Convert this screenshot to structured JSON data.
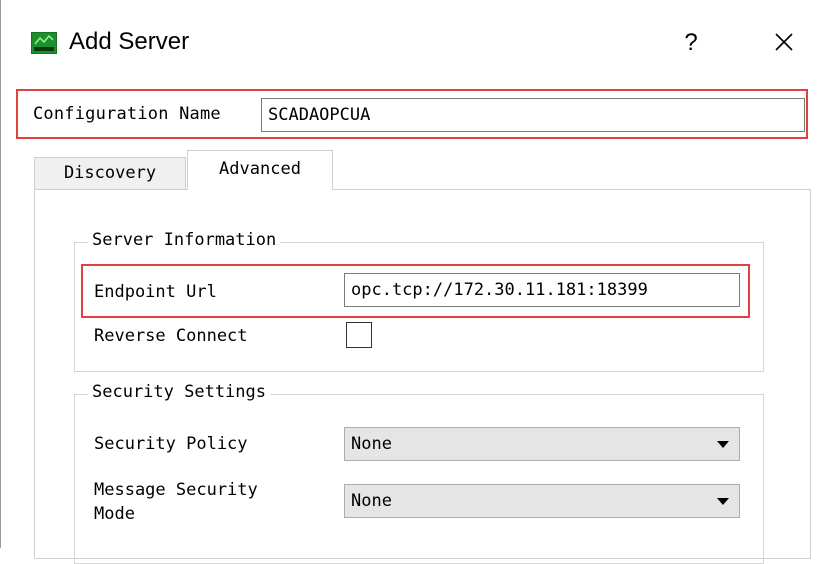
{
  "window": {
    "title": "Add Server",
    "help_label": "?",
    "close_label": "✕",
    "app_icon": "green-app-icon"
  },
  "config": {
    "label": "Configuration Name",
    "value": "SCADAOPCUA"
  },
  "tabs": [
    {
      "label": "Discovery"
    },
    {
      "label": "Advanced"
    }
  ],
  "server_info": {
    "title": "Server Information",
    "endpoint_label": "Endpoint Url",
    "endpoint_value": "opc.tcp://172.30.11.181:18399",
    "reverse_label": "Reverse Connect",
    "reverse_checked": false
  },
  "security": {
    "title": "Security Settings",
    "policy_label": "Security Policy",
    "policy_value": "None",
    "mode_label_1": "Message Security",
    "mode_label_2": "Mode",
    "mode_value": "None"
  },
  "colors": {
    "highlight": "#e0423e",
    "icon_green": "#1e8f2e"
  }
}
